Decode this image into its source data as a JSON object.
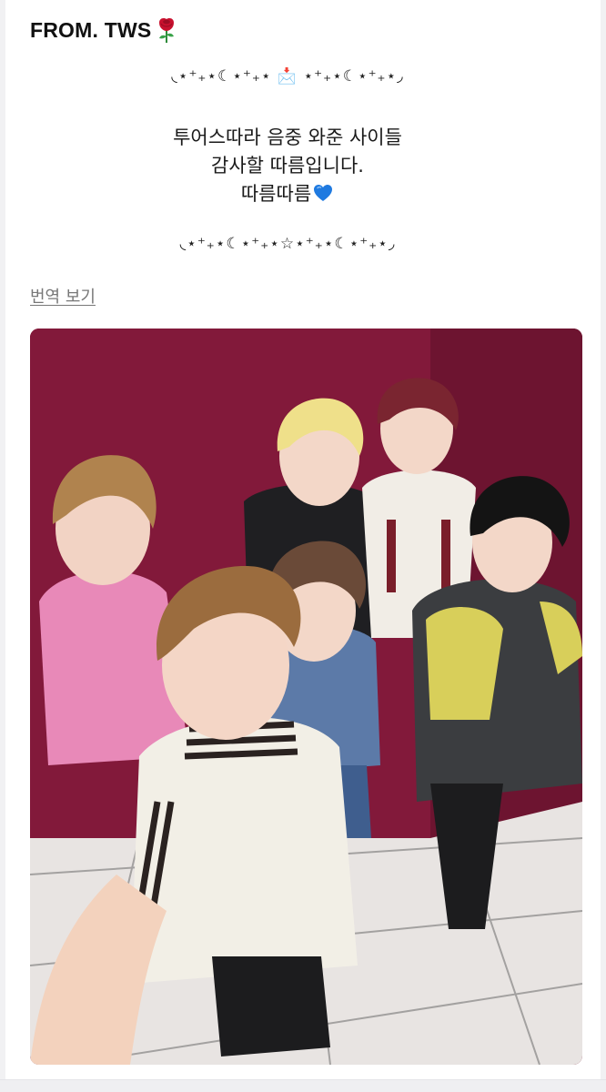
{
  "post": {
    "sender": "FROM. TWS",
    "decoration_top": "◟⋆⁺₊⋆☾⋆⁺₊⋆ 📩 ⋆⁺₊⋆☾⋆⁺₊⋆◞",
    "lines": [
      "투어스따라 음중 와준 사이들",
      "감사할 따름입니다.",
      "따름따름"
    ],
    "decoration_bottom": "◟⋆⁺₊⋆☾⋆⁺₊⋆☆⋆⁺₊⋆☾⋆⁺₊⋆◞",
    "translate_label": "번역 보기"
  },
  "icons": {
    "sender_emoji": "rose-icon",
    "line_emoji": "blue-heart-icon"
  },
  "colors": {
    "wall": "#7a1733",
    "floor": "#e8e4e2",
    "heart": "#1f7ae0",
    "rose": "#c8102e"
  }
}
